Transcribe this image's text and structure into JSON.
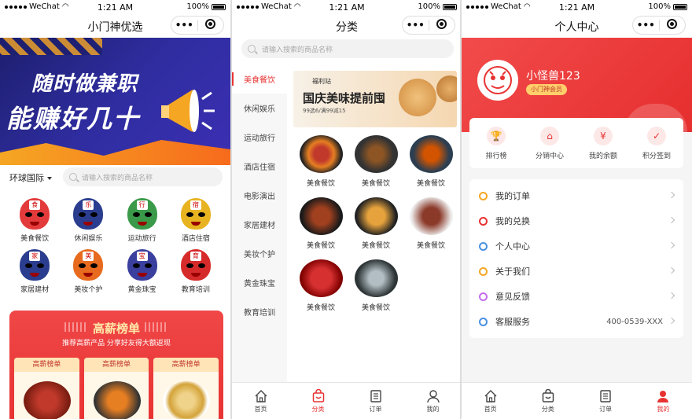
{
  "status": {
    "carrier": "WeChat",
    "time": "1:21 AM",
    "battery": "100%"
  },
  "capsule": {
    "more": "•••"
  },
  "screen1": {
    "title": "小门神优选",
    "banner": {
      "line1": "随时做兼职",
      "line2": "能赚好几十"
    },
    "region": "环球国际",
    "search_placeholder": "请输入搜索的商品名称",
    "categories": [
      {
        "label": "美食餐饮",
        "glyph": "食",
        "color": "#e33b3b"
      },
      {
        "label": "休闲娱乐",
        "glyph": "乐",
        "color": "#2a3d8f"
      },
      {
        "label": "运动旅行",
        "glyph": "行",
        "color": "#3a9a4a"
      },
      {
        "label": "酒店住宿",
        "glyph": "宿",
        "color": "#e8b320"
      },
      {
        "label": "家居建材",
        "glyph": "家",
        "color": "#2a3d8f"
      },
      {
        "label": "美妆个护",
        "glyph": "美",
        "color": "#e86a1e"
      },
      {
        "label": "黄金珠宝",
        "glyph": "宝",
        "color": "#3b3f9e"
      },
      {
        "label": "教育培训",
        "glyph": "育",
        "color": "#d62b2b"
      }
    ],
    "hot": {
      "title": "高薪榜单",
      "subtitle": "推荐高薪产品 分享好友得大额返现",
      "items": [
        {
          "tag": "高薪榜单"
        },
        {
          "tag": "高薪榜单"
        },
        {
          "tag": "高薪榜单"
        }
      ]
    }
  },
  "screen2": {
    "title": "分类",
    "search_placeholder": "请输入搜索的商品名称",
    "sidebar": [
      "美食餐饮",
      "休闲娱乐",
      "运动旅行",
      "酒店住宿",
      "电影演出",
      "家居建材",
      "美妆个护",
      "黄金珠宝",
      "教育培训"
    ],
    "banner": {
      "brand": "福利站",
      "headline": "国庆美味提前囤",
      "promo": "99选6/满99减15"
    },
    "products": [
      {
        "label": "美食餐饮"
      },
      {
        "label": "美食餐饮"
      },
      {
        "label": "美食餐饮"
      },
      {
        "label": "美食餐饮"
      },
      {
        "label": "美食餐饮"
      },
      {
        "label": "美食餐饮"
      },
      {
        "label": "美食餐饮"
      },
      {
        "label": "美食餐饮"
      }
    ]
  },
  "screen3": {
    "title": "个人中心",
    "user": {
      "name": "小怪兽123",
      "badge": "小门神会员"
    },
    "quick": [
      {
        "label": "排行榜"
      },
      {
        "label": "分销中心"
      },
      {
        "label": "我的余额"
      },
      {
        "label": "积分签到"
      }
    ],
    "menu": [
      {
        "label": "我的订单",
        "value": "",
        "color": "#f5a623"
      },
      {
        "label": "我的兑换",
        "value": "",
        "color": "#e83232"
      },
      {
        "label": "个人中心",
        "value": "",
        "color": "#4a90e2"
      },
      {
        "label": "关于我们",
        "value": "",
        "color": "#f5a623"
      },
      {
        "label": "意见反馈",
        "value": "",
        "color": "#c56cf0"
      },
      {
        "label": "客服服务",
        "value": "400-0539-XXX",
        "color": "#4a90e2"
      }
    ]
  },
  "tabbar": {
    "home": "首页",
    "category": "分类",
    "orders": "订单",
    "mine": "我的"
  },
  "colors": {
    "accent": "#e83232"
  }
}
